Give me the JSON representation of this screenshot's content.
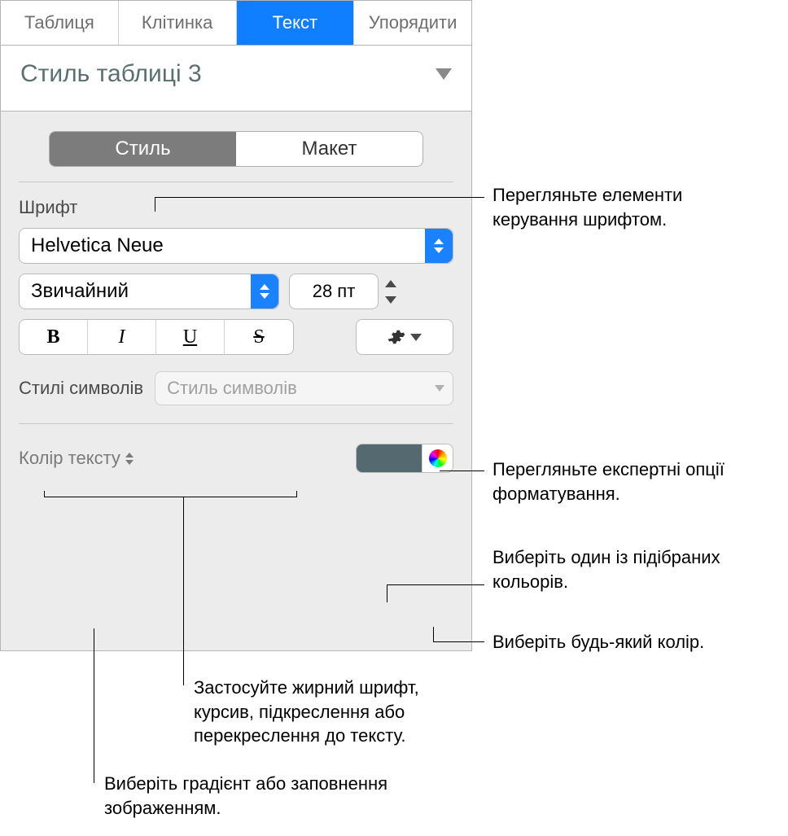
{
  "tabs": {
    "table": "Таблиця",
    "cell": "Клітинка",
    "text": "Текст",
    "arrange": "Упорядити"
  },
  "style_name": "Стиль таблиці 3",
  "segmented": {
    "style": "Стиль",
    "layout": "Макет"
  },
  "font_section_label": "Шрифт",
  "font_family": "Helvetica Neue",
  "font_weight": "Звичайний",
  "font_size": "28 пт",
  "bius": {
    "bold": "B",
    "italic": "I",
    "underline": "U",
    "strike": "S"
  },
  "char_styles_label": "Стилі символів",
  "char_styles_placeholder": "Стиль символів",
  "text_color_label": "Колір тексту",
  "text_color_value": "#556a70",
  "callouts": {
    "font_controls": "Перегляньте елементи керування шрифтом.",
    "expert_options": "Перегляньте експертні опції форматування.",
    "preset_color": "Виберіть один із підібраних кольорів.",
    "any_color": "Виберіть будь-який колір.",
    "bius": "Застосуйте жирний шрифт, курсив, підкреслення або перекреслення до тексту.",
    "gradient_fill": "Виберіть градієнт або заповнення зображенням."
  }
}
